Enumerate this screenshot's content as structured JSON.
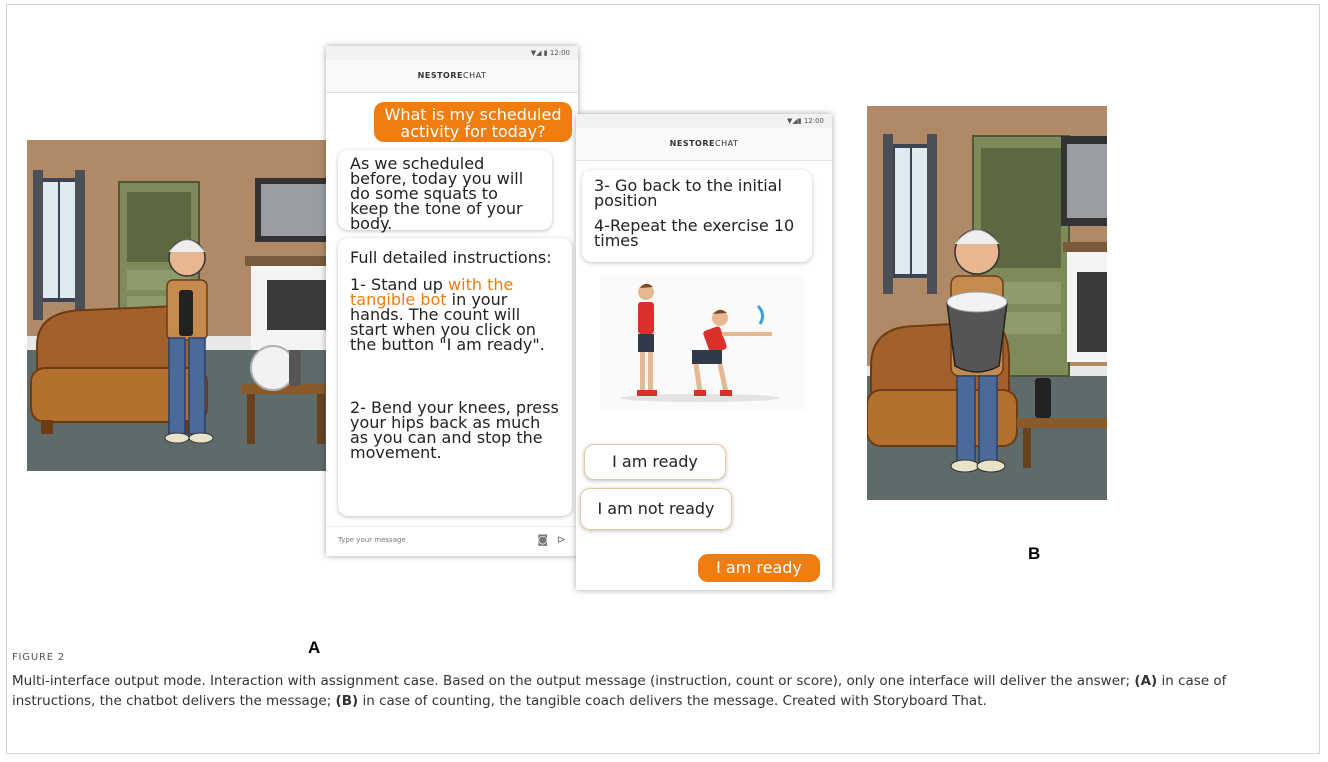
{
  "phone_a": {
    "status_time": "12:00",
    "header_brand": "NESTORE",
    "header_suffix": "CHAT",
    "user_message": "What is my scheduled activity for today?",
    "bot_message_1": "As we scheduled before, today you will do some squats to keep the tone of your body.",
    "instructions_title": "Full detailed instructions:",
    "step1_prefix": "1- Stand up ",
    "step1_highlight": "with the tangible bot",
    "step1_suffix": " in your hands. The count will start when you click on the button \"I am ready\".",
    "step2": "2- Bend your knees, press your hips back as much as you can and stop the movement.",
    "composer_placeholder": "Type your message"
  },
  "phone_b": {
    "status_time": "12:00",
    "header_brand": "NESTORE",
    "header_suffix": "CHAT",
    "step3": "3- Go back to the initial position",
    "step4": "4-Repeat the exercise 10 times",
    "choice_ready": "I am ready",
    "choice_not_ready": "I am not ready",
    "user_reply": "I am ready"
  },
  "labels": {
    "a": "A",
    "b": "B"
  },
  "caption": {
    "figure_label": "FIGURE 2",
    "text_1": "Multi-interface output mode. Interaction with assignment case. Based on the output message (instruction, count or score), only one interface will deliver the answer; ",
    "part_a": "(A)",
    "text_2": " in case of instructions, the chatbot delivers the message; ",
    "part_b": "(B)",
    "text_3": " in case of counting, the tangible coach delivers the message. Created with Storyboard That."
  },
  "colors": {
    "accent": "#ef7d10",
    "wall": "#b08a67",
    "floor": "#5f6b6b",
    "sofa": "#a4602a"
  },
  "icons": [
    "camera-icon",
    "send-icon",
    "wifi-icon",
    "signal-icon",
    "battery-icon"
  ]
}
